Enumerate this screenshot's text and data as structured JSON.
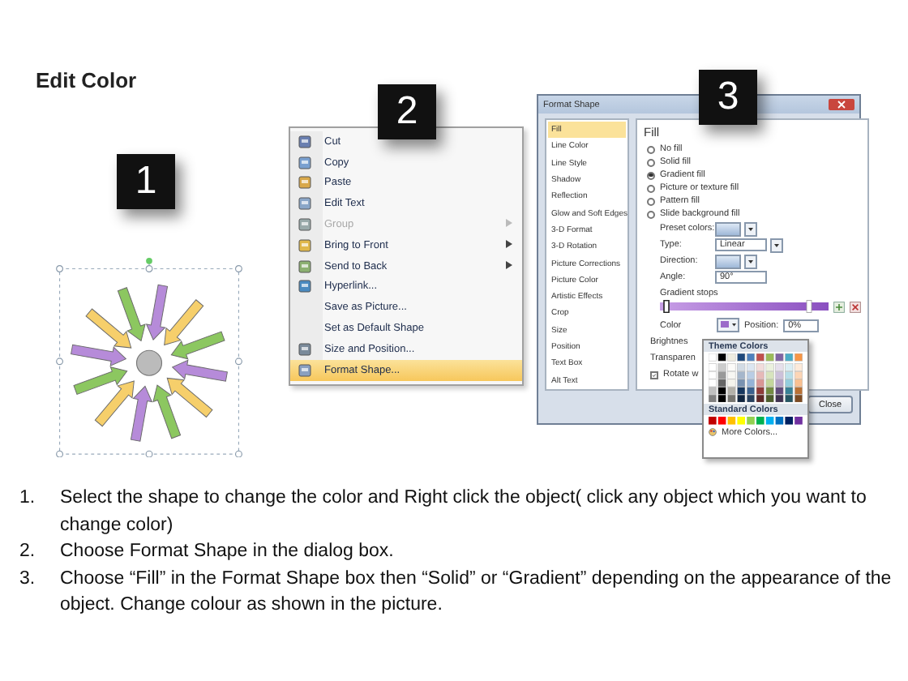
{
  "title": "Edit Color",
  "shape_panel": {
    "badge": "1"
  },
  "context_menu": {
    "badge": "2",
    "items": [
      {
        "label": "Cut",
        "disabled": false,
        "submenu": false,
        "selected": false
      },
      {
        "label": "Copy",
        "disabled": false,
        "submenu": false,
        "selected": false
      },
      {
        "label": "Paste",
        "disabled": false,
        "submenu": false,
        "selected": false
      },
      {
        "label": "Edit Text",
        "disabled": false,
        "submenu": false,
        "selected": false
      },
      {
        "label": "Group",
        "disabled": true,
        "submenu": true,
        "selected": false
      },
      {
        "label": "Bring to Front",
        "disabled": false,
        "submenu": true,
        "selected": false
      },
      {
        "label": "Send to Back",
        "disabled": false,
        "submenu": true,
        "selected": false
      },
      {
        "label": "Hyperlink...",
        "disabled": false,
        "submenu": false,
        "selected": false
      },
      {
        "label": "Save as Picture...",
        "disabled": false,
        "submenu": false,
        "selected": false
      },
      {
        "label": "Set as Default Shape",
        "disabled": false,
        "submenu": false,
        "selected": false
      },
      {
        "label": "Size and Position...",
        "disabled": false,
        "submenu": false,
        "selected": false
      },
      {
        "label": "Format Shape...",
        "disabled": false,
        "submenu": false,
        "selected": true
      }
    ]
  },
  "format_shape": {
    "badge": "3",
    "title": "Format Shape",
    "categories": [
      {
        "label": "Fill",
        "selected": true
      },
      {
        "label": "Line Color",
        "selected": false
      },
      {
        "label": "Line Style",
        "selected": false
      },
      {
        "label": "Shadow",
        "selected": false
      },
      {
        "label": "Reflection",
        "selected": false
      },
      {
        "label": "Glow and Soft Edges",
        "selected": false
      },
      {
        "label": "3-D Format",
        "selected": false
      },
      {
        "label": "3-D Rotation",
        "selected": false
      },
      {
        "label": "Picture Corrections",
        "selected": false
      },
      {
        "label": "Picture Color",
        "selected": false
      },
      {
        "label": "Artistic Effects",
        "selected": false
      },
      {
        "label": "Crop",
        "selected": false
      },
      {
        "label": "Size",
        "selected": false
      },
      {
        "label": "Position",
        "selected": false
      },
      {
        "label": "Text Box",
        "selected": false
      },
      {
        "label": "Alt Text",
        "selected": false
      }
    ],
    "section_title": "Fill",
    "fill_options": [
      {
        "label": "No fill",
        "selected": false
      },
      {
        "label": "Solid fill",
        "selected": false
      },
      {
        "label": "Gradient fill",
        "selected": true
      },
      {
        "label": "Picture or texture fill",
        "selected": false
      },
      {
        "label": "Pattern fill",
        "selected": false
      },
      {
        "label": "Slide background fill",
        "selected": false
      }
    ],
    "fields": [
      {
        "label": "Preset colors:",
        "kind": "swatch"
      },
      {
        "label": "Type:",
        "kind": "select",
        "value": "Linear"
      },
      {
        "label": "Direction:",
        "kind": "swatch"
      },
      {
        "label": "Angle:",
        "kind": "spin",
        "value": "90°"
      }
    ],
    "gradient_stops_label": "Gradient stops",
    "gradient_stops": [
      {
        "level": 0.02,
        "selected": true
      },
      {
        "level": 0.9,
        "selected": false
      }
    ],
    "color_label": "Color",
    "position_label": "Position:",
    "position_value": "0%",
    "brightness_label": "Brightnes",
    "transparency_label": "Transparen",
    "rotate": {
      "label": "Rotate w",
      "checked": true
    },
    "close_button": "Close",
    "color_popup": {
      "theme_heading": "Theme Colors",
      "standard_heading": "Standard Colors",
      "more": "More Colors..."
    }
  },
  "instructions": [
    {
      "number": "1.",
      "text": "Select the shape to change the color and Right click the object( click any object which you want to change color)"
    },
    {
      "number": "2.",
      "text": "Choose Format Shape in the dialog box."
    },
    {
      "number": "3.",
      "text": "Choose “Fill” in the Format Shape box then “Solid” or “Gradient” depending on the appearance of the object. Change colour as shown in the picture."
    }
  ]
}
